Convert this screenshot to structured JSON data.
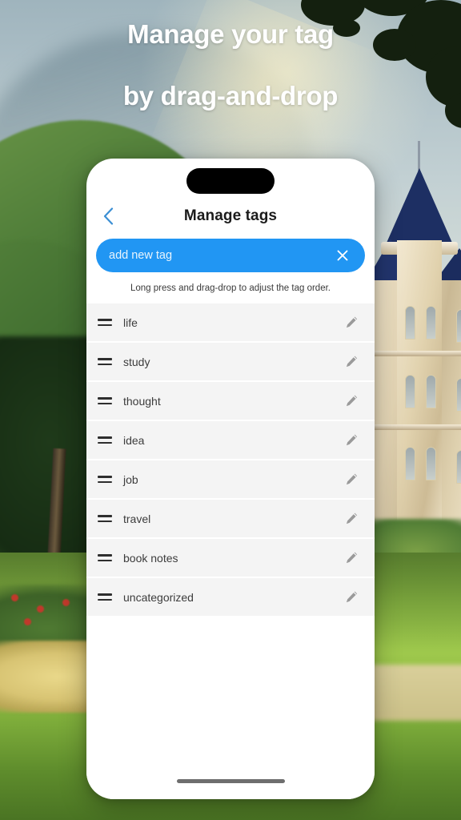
{
  "headline": {
    "line1": "Manage your tag",
    "line2": "by drag-and-drop",
    "color": "#ffffff"
  },
  "phone": {
    "navbar": {
      "back_icon": "chevron-left-icon",
      "back_color": "#3b8fd4",
      "title": "Manage tags"
    },
    "add_tag_field": {
      "value": "",
      "placeholder": "add new tag",
      "background": "#2196f3",
      "text_color": "#ffffff",
      "clear_icon": "close-icon"
    },
    "hint": "Long press and drag-drop to adjust the tag order.",
    "row_background": "#f4f4f4",
    "handle_icon": "drag-handle-icon",
    "edit_icon": "pencil-icon",
    "tags": [
      {
        "label": "life"
      },
      {
        "label": "study"
      },
      {
        "label": "thought"
      },
      {
        "label": "idea"
      },
      {
        "label": "job"
      },
      {
        "label": "travel"
      },
      {
        "label": "book notes"
      },
      {
        "label": "uncategorized"
      }
    ],
    "home_indicator": "home-indicator"
  }
}
